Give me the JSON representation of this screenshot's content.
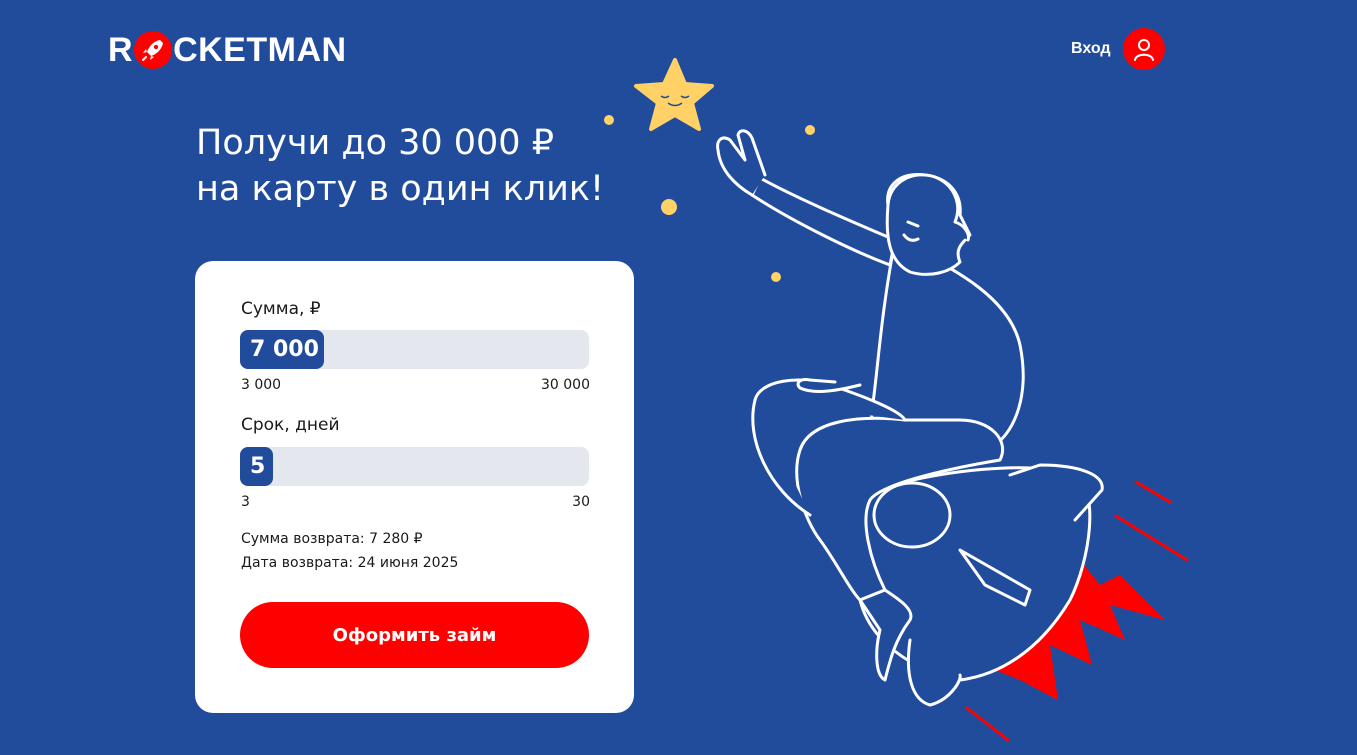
{
  "brand": {
    "logo_prefix": "R",
    "logo_suffix": "CKETMAN",
    "accent": "#ff0000",
    "background": "#214c9b"
  },
  "header": {
    "login_label": "Вход",
    "login_icon": "user-icon"
  },
  "hero": {
    "line1": "Получи до 30 000 ₽",
    "line2": "на карту в один клик!"
  },
  "calculator": {
    "amount": {
      "label": "Сумма, ₽",
      "value": "7 000",
      "min": "3 000",
      "max": "30 000",
      "fill_fraction": 0.15
    },
    "term": {
      "label": "Срок, дней",
      "value": "5",
      "min": "3",
      "max": "30",
      "fill_fraction": 0.07
    },
    "repay_amount": "Сумма возврата: 7 280 ₽",
    "repay_date": "Дата возврата: 24 июня 2025",
    "submit_label": "Оформить займ"
  },
  "illustration": {
    "icons": [
      "star-icon",
      "rocket-icon"
    ],
    "star_color": "#ffd166",
    "flame_color": "#ff0000"
  }
}
